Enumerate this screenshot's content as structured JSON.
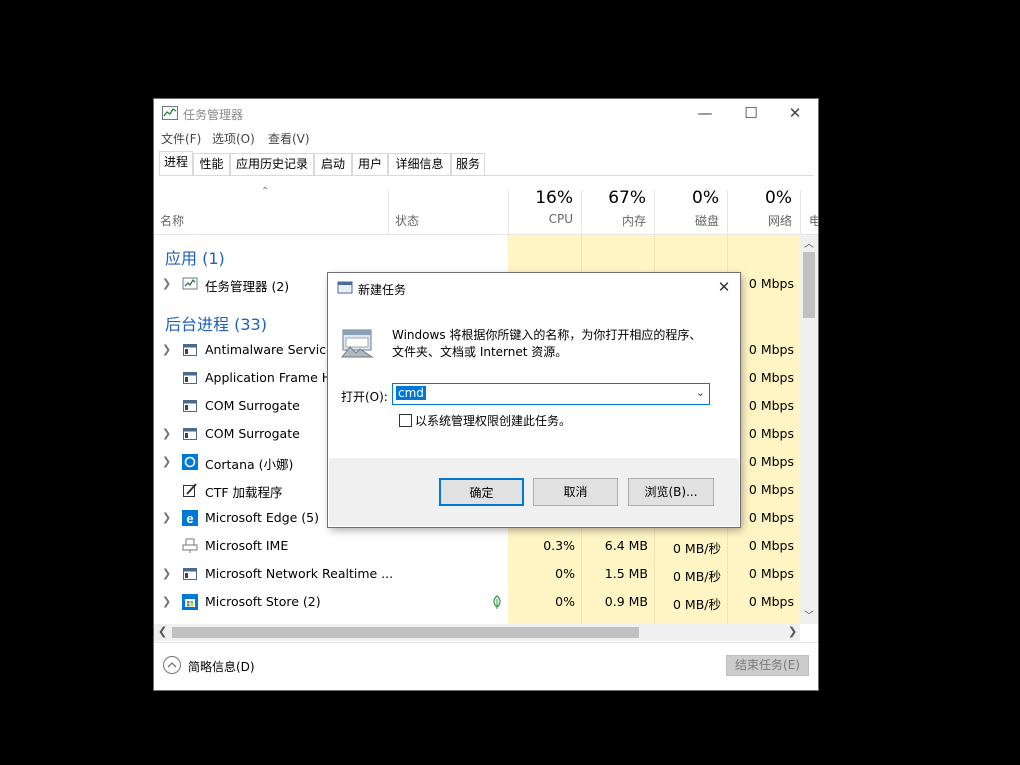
{
  "window": {
    "title": "任务管理器"
  },
  "menu": [
    "文件(F)",
    "选项(O)",
    "查看(V)"
  ],
  "tabs": [
    "进程",
    "性能",
    "应用历史记录",
    "启动",
    "用户",
    "详细信息",
    "服务"
  ],
  "columns": {
    "name": "名称",
    "status": "状态",
    "cpu": {
      "pct": "16%",
      "label": "CPU"
    },
    "mem": {
      "pct": "67%",
      "label": "内存"
    },
    "disk": {
      "pct": "0%",
      "label": "磁盘"
    },
    "net": {
      "pct": "0%",
      "label": "网络"
    },
    "power": "电"
  },
  "groups": {
    "apps": "应用 (1)",
    "background": "后台进程 (33)"
  },
  "rows": [
    {
      "name": "任务管理器 (2)",
      "net": "0 Mbps"
    },
    {
      "name": "Antimalware Service E",
      "net": "0 Mbps"
    },
    {
      "name": "Application Frame Ho",
      "net": "0 Mbps"
    },
    {
      "name": "COM Surrogate",
      "net": "0 Mbps"
    },
    {
      "name": "COM Surrogate",
      "net": "0 Mbps"
    },
    {
      "name": "Cortana (小娜)",
      "net": "0 Mbps"
    },
    {
      "name": "CTF 加载程序",
      "net": "0 Mbps"
    },
    {
      "name": "Microsoft Edge (5)",
      "net": "0 Mbps"
    },
    {
      "name": "Microsoft IME",
      "cpu": "0.3%",
      "mem": "6.4 MB",
      "disk": "0 MB/秒",
      "net": "0 Mbps"
    },
    {
      "name": "Microsoft Network Realtime ...",
      "cpu": "0%",
      "mem": "1.5 MB",
      "disk": "0 MB/秒",
      "net": "0 Mbps"
    },
    {
      "name": "Microsoft Store (2)",
      "cpu": "0%",
      "mem": "0.9 MB",
      "disk": "0 MB/秒",
      "net": "0 Mbps"
    }
  ],
  "footer": {
    "fewer_details": "简略信息(D)",
    "end_task": "结束任务(E)"
  },
  "dialog": {
    "title": "新建任务",
    "desc1": "Windows 将根据你所键入的名称，为你打开相应的程序、",
    "desc2": "文件夹、文档或 Internet 资源。",
    "open_label": "打开(O):",
    "open_value": "cmd",
    "admin_label": "以系统管理权限创建此任务。",
    "admin_checked": false,
    "ok": "确定",
    "cancel": "取消",
    "browse": "浏览(B)..."
  },
  "colors": {
    "accent": "#1f5fbf",
    "heat": "#fff4c4",
    "selection": "#0078d7"
  }
}
